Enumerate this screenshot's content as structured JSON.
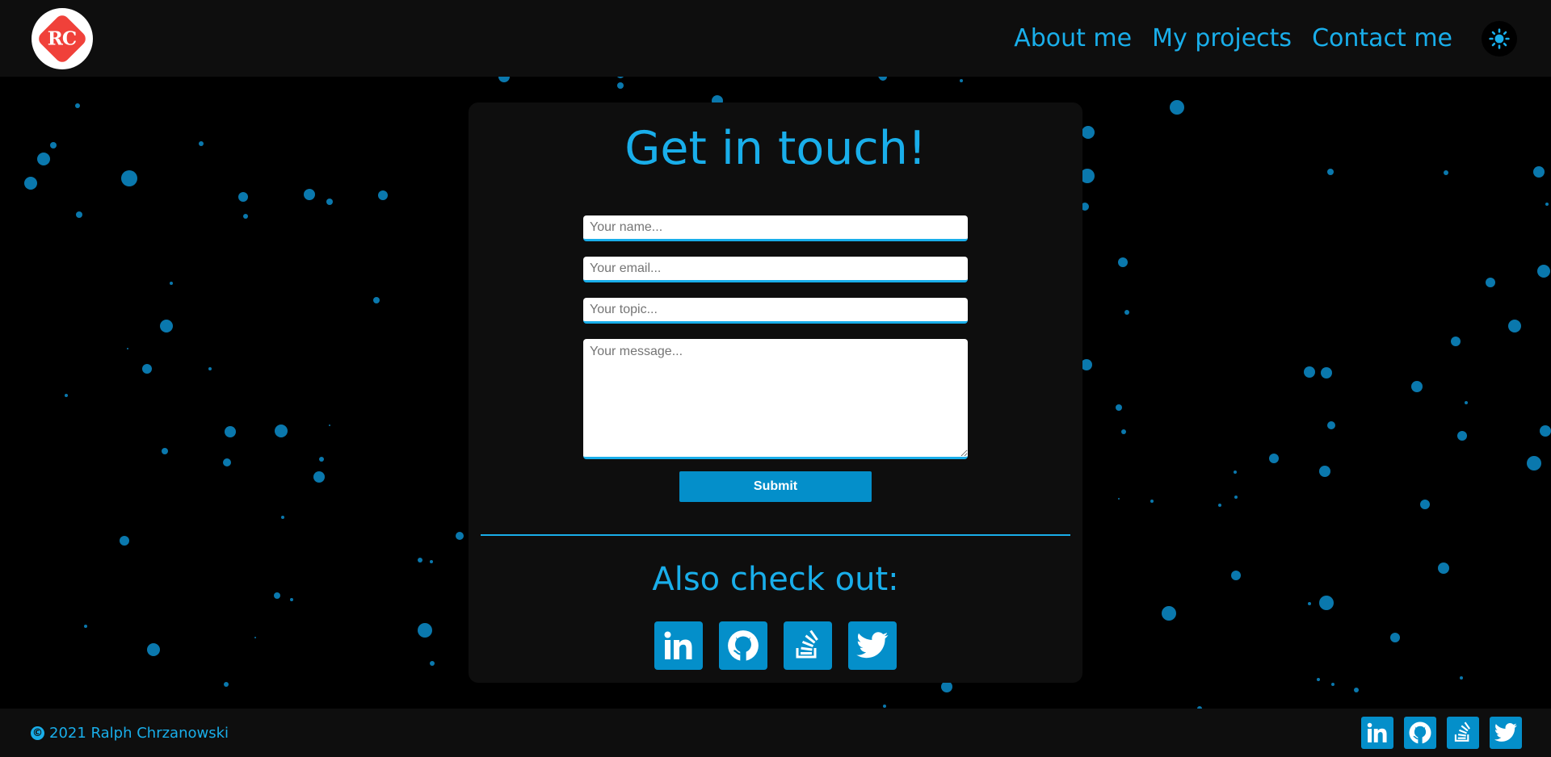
{
  "header": {
    "logo_text": "RC",
    "nav": [
      {
        "label": "About me"
      },
      {
        "label": "My projects"
      },
      {
        "label": "Contact me"
      }
    ],
    "theme_icon": "sun-icon"
  },
  "contact": {
    "title": "Get in touch!",
    "name_placeholder": "Your name...",
    "email_placeholder": "Your email...",
    "topic_placeholder": "Your topic...",
    "message_placeholder": "Your message...",
    "submit_label": "Submit"
  },
  "also": {
    "title": "Also check out:",
    "links": [
      "linkedin-icon",
      "github-icon",
      "stackoverflow-icon",
      "twitter-icon"
    ]
  },
  "footer": {
    "copyright": "2021 Ralph Chrzanowski",
    "links": [
      "linkedin-icon",
      "github-icon",
      "stackoverflow-icon",
      "twitter-icon"
    ]
  },
  "colors": {
    "accent": "#19aeea",
    "button": "#048fca",
    "surface": "#0e0e0e",
    "background": "#000000",
    "logo_red": "#f0413a"
  }
}
